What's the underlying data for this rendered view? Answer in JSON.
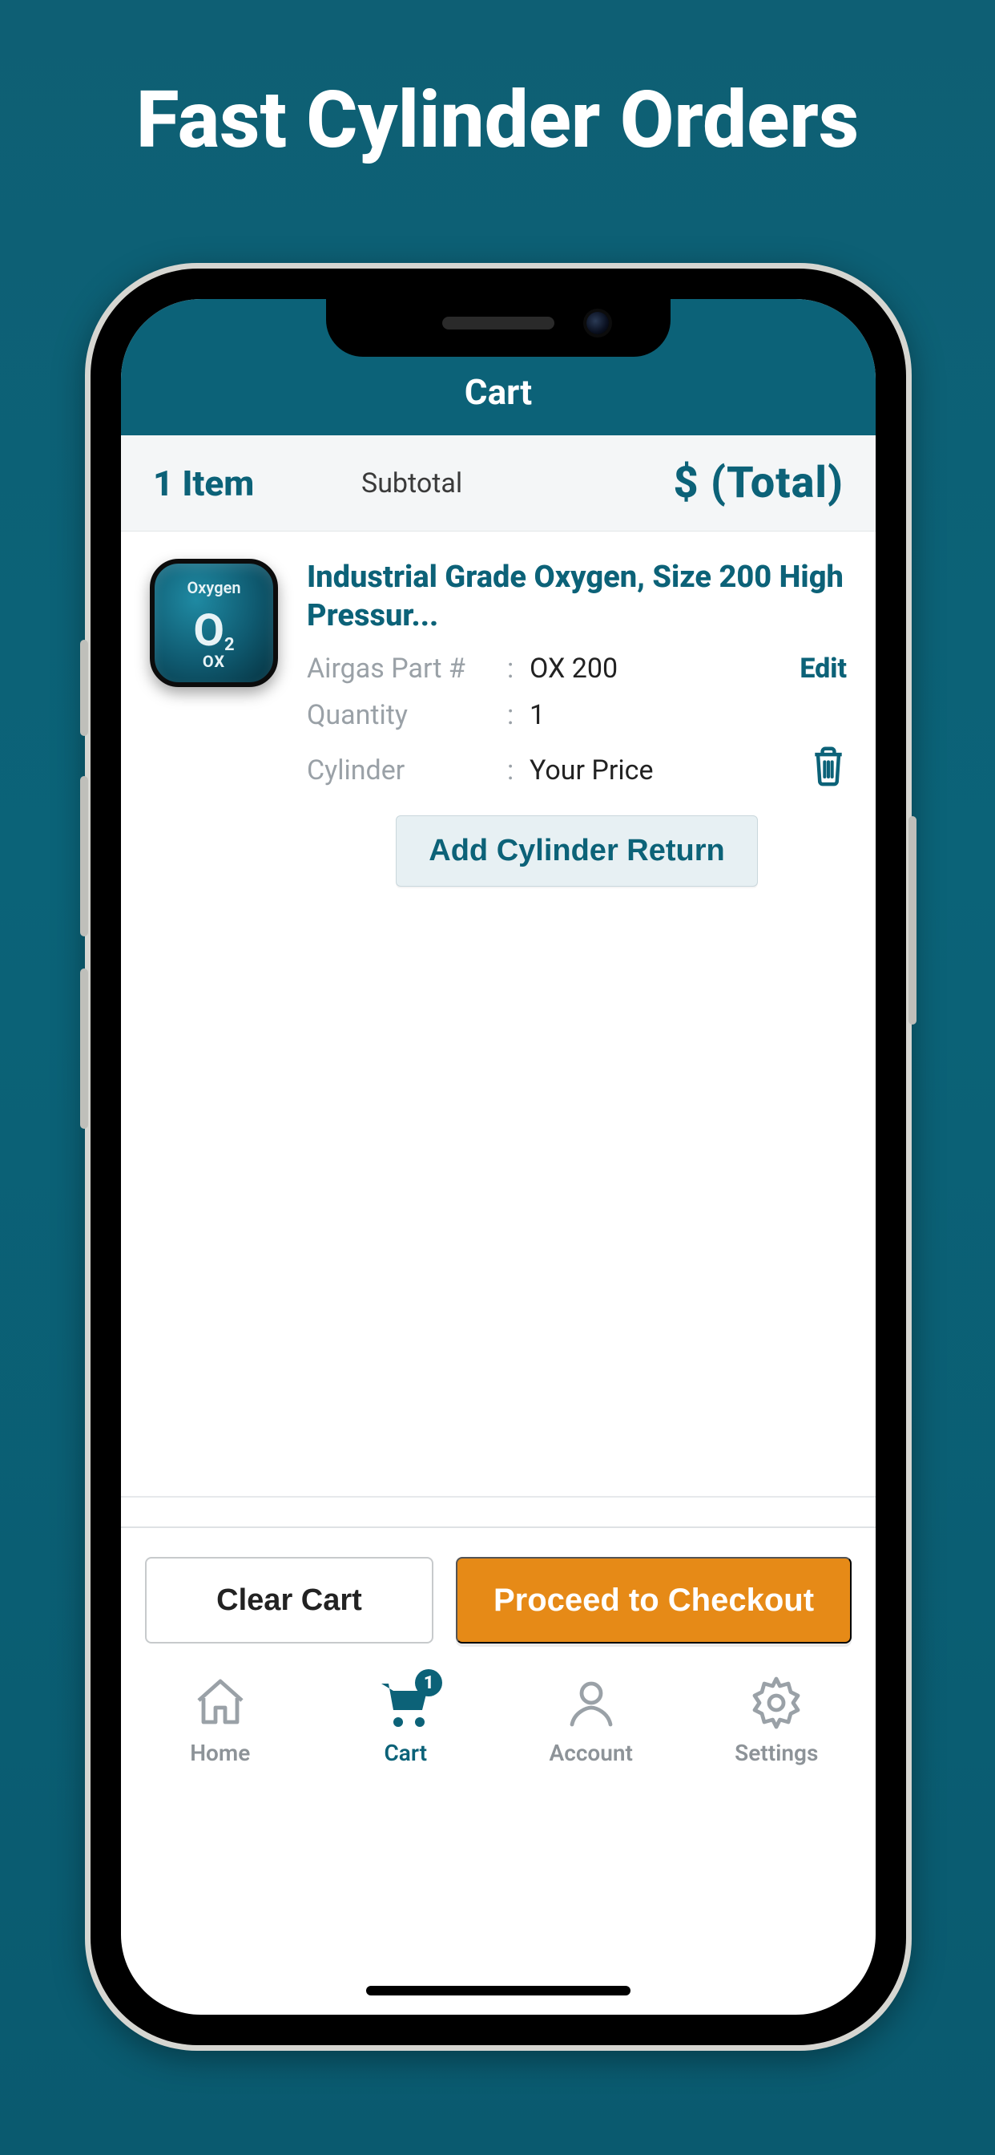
{
  "promo": {
    "title": "Fast Cylinder Orders"
  },
  "appbar": {
    "title": "Cart"
  },
  "summary": {
    "items_label": "1 Item",
    "subtotal_label": "Subtotal",
    "total_text": "$ (Total)"
  },
  "item": {
    "title": "Industrial Grade Oxygen, Size 200 High Pressur...",
    "thumb": {
      "top": "Oxygen",
      "mid": "O",
      "sub": "2",
      "bottom": "OX"
    },
    "rows": {
      "part_label": "Airgas Part #",
      "part_value": "OX 200",
      "qty_label": "Quantity",
      "qty_value": "1",
      "cyl_label": "Cylinder",
      "cyl_value": "Your Price"
    },
    "edit_label": "Edit",
    "add_return_label": "Add Cylinder Return"
  },
  "footer": {
    "clear_label": "Clear Cart",
    "checkout_label": "Proceed to Checkout"
  },
  "tabs": {
    "home": "Home",
    "cart": "Cart",
    "account": "Account",
    "settings": "Settings",
    "badge": "1"
  }
}
